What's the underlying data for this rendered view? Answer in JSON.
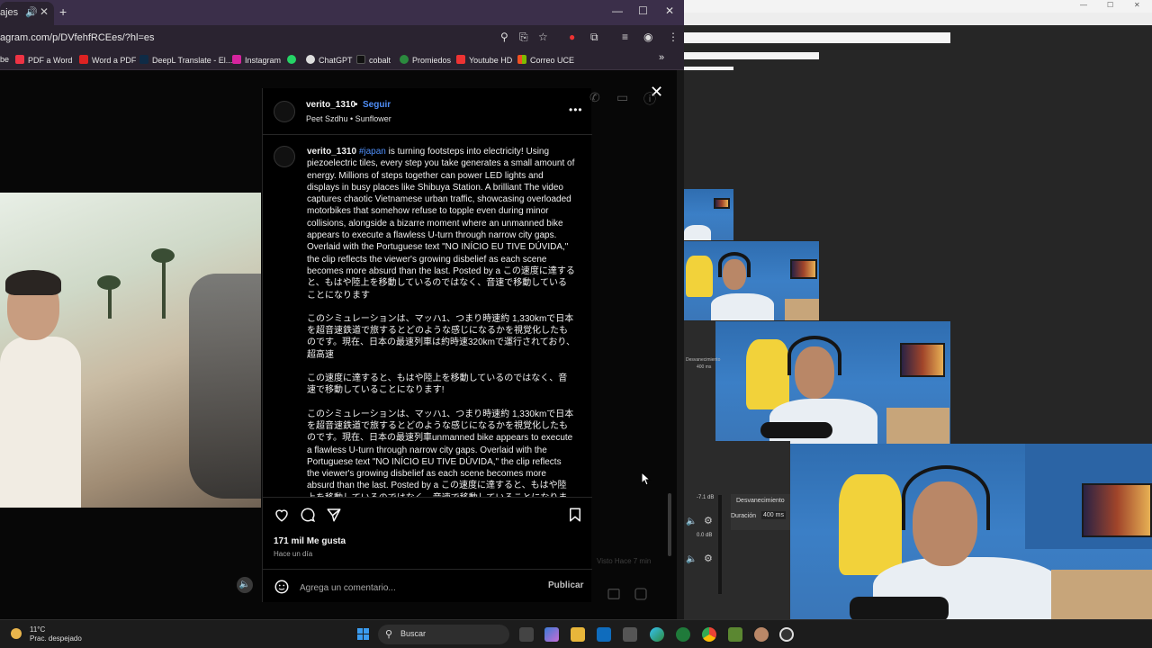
{
  "browser": {
    "tab_title": "ajes",
    "url": "agram.com/p/DVfehfRCEes/?hl=es",
    "bookmarks": [
      {
        "label": "be",
        "color": "#e33"
      },
      {
        "label": "PDF a Word",
        "color": "#e34"
      },
      {
        "label": "Word a PDF",
        "color": "#d22"
      },
      {
        "label": "DeepL Translate - El...",
        "color": "#0f2b46"
      },
      {
        "label": "Instagram",
        "color": "#d6249f"
      },
      {
        "label": "",
        "color": "#25d366"
      },
      {
        "label": "ChatGPT",
        "color": "#ddd"
      },
      {
        "label": "cobalt",
        "color": "#111"
      },
      {
        "label": "Promiedos",
        "color": "#2b8a3e"
      },
      {
        "label": "Youtube HD",
        "color": "#e33"
      },
      {
        "label": "Correo UCE",
        "color": "#f25022"
      }
    ]
  },
  "post": {
    "username": "verito_1310",
    "follow_label": "Seguir",
    "song": "Peet Szdhu • Sunflower",
    "caption_user": "verito_1310",
    "caption_tag": "#japan",
    "caption_p1": " is turning footsteps into electricity! Using piezoelectric tiles, every step you take generates a small amount of energy. Millions of steps together can power LED lights and displays in busy places like Shibuya Station. A brilliant The video captures chaotic Vietnamese urban traffic, showcasing overloaded motorbikes that somehow refuse to topple even during minor collisions, alongside a bizarre moment where an unmanned bike appears to execute a flawless U-turn through narrow city gaps. Overlaid with the Portuguese text \"NO INÍCIO EU TIVE DÚVIDA,\" the clip reflects the viewer's growing disbelief as each scene becomes more absurd than the last. Posted by a この速度に達すると、もはや陸上を移動しているのではなく、音速で移動していることになります",
    "caption_p2": "このシミュレーションは、マッハ1、つまり時速約 1,330kmで日本を超音速鉄道で旅するとどのような感じになるかを視覚化したものです。現在、日本の最速列車は約時速320kmで運行されており、超高速",
    "caption_p3": "この速度に達すると、もはや陸上を移動しているのではなく、音速で移動していることになります!",
    "caption_p4": "このシミュレーションは、マッハ1、つまり時速約 1,330kmで日本を超音速鉄道で旅するとどのような感じになるかを視覚化したものです。現在、日本の最速列車unmanned bike appears to execute a flawless U-turn through narrow city gaps. Overlaid with the Portuguese text \"NO INÍCIO EU TIVE DÚVIDA,\" the clip reflects the viewer's growing disbelief as each scene becomes more absurd than the last. Posted by a この速度に達すると、もはや陸上を移動しているのではなく、音速で移動していることになります",
    "likes": "171 mil Me gusta",
    "time_ago": "Hace un día",
    "comment_placeholder": "Agrega un comentario...",
    "publish_label": "Publicar",
    "seen_label": "Visto Hace 7 min"
  },
  "obs": {
    "transition_label": "Desvanecimiento",
    "duration_label": "Duración",
    "duration_value": "400 ms",
    "db1": "-7.1 dB",
    "db2": "0.0 dB",
    "small_dur": "400 ms"
  },
  "taskbar": {
    "temp": "11°C",
    "weather": "Prac. despejado",
    "search_label": "Buscar"
  },
  "colors": {
    "accent_link": "#4f8ef7",
    "tabstrip": "#3b2f4a"
  }
}
